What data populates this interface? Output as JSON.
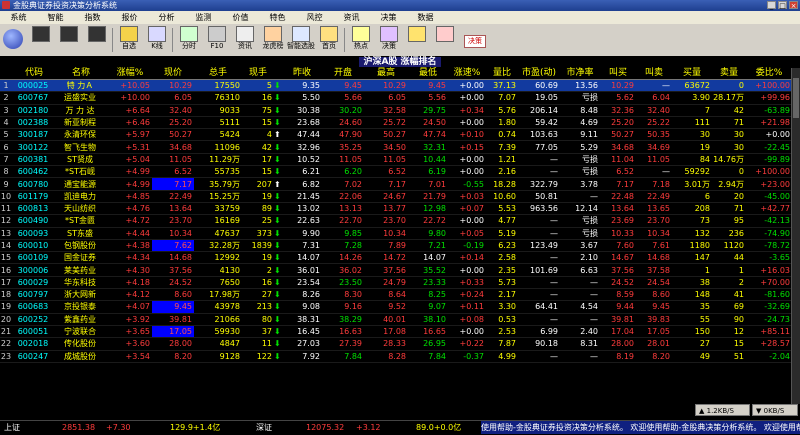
{
  "window": {
    "title": "金股典证券投资决策分析系统"
  },
  "menu": [
    "系统",
    "智能",
    "指数",
    "报价",
    "分析",
    "监测",
    "价值",
    "特色",
    "风控",
    "资讯",
    "决策",
    "数据"
  ],
  "toolbar": [
    {
      "label": "",
      "icon": "dark-panel-icon"
    },
    {
      "label": "",
      "icon": "dark-panel-icon"
    },
    {
      "label": "",
      "icon": "dark-panel-icon"
    },
    {
      "label": "自选",
      "icon": "watchlist-icon"
    },
    {
      "label": "K线",
      "icon": "kline-icon"
    },
    {
      "label": "分时",
      "icon": "intraday-icon"
    },
    {
      "label": "F10",
      "icon": "f10-icon"
    },
    {
      "label": "资讯",
      "icon": "news-icon"
    },
    {
      "label": "龙虎榜",
      "icon": "ranking-icon"
    },
    {
      "label": "智能选股",
      "icon": "smart-pick-icon"
    },
    {
      "label": "首页",
      "icon": "home-icon"
    },
    {
      "label": "热点",
      "icon": "hotspot-icon"
    },
    {
      "label": "决策",
      "icon": "decision-icon"
    },
    {
      "label": "",
      "icon": "star-icon"
    },
    {
      "label": "",
      "icon": "flag-icon"
    }
  ],
  "control_button": "决策",
  "sheet": {
    "title": "沪深A股 涨幅排名"
  },
  "columns": [
    "",
    "代码",
    "名称",
    "涨幅%",
    "现价",
    "总手",
    "现手",
    "",
    "昨收",
    "开盘",
    "最高",
    "最低",
    "涨速%",
    "量比",
    "市盈(动)",
    "市净率",
    "叫买",
    "叫卖",
    "买量",
    "卖量",
    "委比%"
  ],
  "rows": [
    [
      "1",
      "000025",
      "特 力Ａ",
      "+10.05",
      "10.29",
      "17550",
      "5",
      "dn",
      "9.35",
      "9.45",
      "10.29",
      "9.45",
      "+0.00",
      "37.13",
      "60.69",
      "13.56",
      "10.29",
      "—",
      "63672",
      "0",
      "+100.00"
    ],
    [
      "2",
      "600767",
      "运盛实业",
      "+10.00",
      "6.05",
      "76310",
      "16",
      "dn",
      "5.50",
      "5.66",
      "6.05",
      "5.56",
      "+0.00",
      "7.07",
      "19.05",
      "亏损",
      "5.62",
      "6.04",
      "3.90",
      "28.17万",
      "+99.96"
    ],
    [
      "3",
      "002180",
      "万 力 达",
      "+6.64",
      "32.40",
      "9033",
      "75",
      "dn",
      "30.38",
      "30.20",
      "32.58",
      "29.75",
      "+0.34",
      "5.76",
      "206.14",
      "8.48",
      "32.36",
      "32.40",
      "7",
      "42",
      "-63.89"
    ],
    [
      "4",
      "002388",
      "新亚制程",
      "+6.46",
      "25.20",
      "5111",
      "15",
      "dn",
      "23.68",
      "24.60",
      "25.72",
      "24.50",
      "+0.00",
      "1.80",
      "59.42",
      "4.69",
      "25.20",
      "25.22",
      "111",
      "71",
      "+21.98"
    ],
    [
      "5",
      "300187",
      "永清环保",
      "+5.97",
      "50.27",
      "5424",
      "4",
      "up",
      "47.44",
      "47.90",
      "50.27",
      "47.74",
      "+0.10",
      "0.74",
      "103.63",
      "9.11",
      "50.27",
      "50.35",
      "30",
      "30",
      "+0.00"
    ],
    [
      "6",
      "300122",
      "智飞生物",
      "+5.31",
      "34.68",
      "11096",
      "42",
      "dn",
      "32.96",
      "35.25",
      "34.50",
      "32.31",
      "+0.15",
      "7.39",
      "77.05",
      "5.29",
      "34.68",
      "34.69",
      "19",
      "30",
      "-22.45"
    ],
    [
      "7",
      "600381",
      "ST贤成",
      "+5.04",
      "11.05",
      "11.29万",
      "17",
      "dn",
      "10.52",
      "11.05",
      "11.05",
      "10.44",
      "+0.00",
      "1.21",
      "—",
      "亏损",
      "11.04",
      "11.05",
      "84",
      "14.76万",
      "-99.89"
    ],
    [
      "8",
      "600462",
      "*ST石岘",
      "+4.99",
      "6.52",
      "55735",
      "15",
      "dn",
      "6.21",
      "6.20",
      "6.52",
      "6.19",
      "+0.00",
      "2.16",
      "—",
      "亏损",
      "6.52",
      "—",
      "59292",
      "0",
      "+100.00"
    ],
    [
      "9",
      "600780",
      "通宝能源",
      "+4.99",
      "7.17",
      "35.79万",
      "207",
      "up",
      "6.82",
      "7.02",
      "7.17",
      "7.01",
      "-0.55",
      "18.28",
      "322.79",
      "3.78",
      "7.17",
      "7.18",
      "3.01万",
      "2.94万",
      "+23.00"
    ],
    [
      "10",
      "601179",
      "凯迪电力",
      "+4.85",
      "22.49",
      "15.25万",
      "19",
      "dn",
      "21.45",
      "22.06",
      "24.67",
      "21.79",
      "+0.03",
      "10.60",
      "50.81",
      "—",
      "22.48",
      "22.49",
      "6",
      "20",
      "-45.00"
    ],
    [
      "11",
      "600813",
      "天山纺织",
      "+4.76",
      "13.64",
      "33759",
      "89",
      "dn",
      "13.02",
      "13.13",
      "13.77",
      "12.98",
      "+0.07",
      "5.53",
      "963.56",
      "12.14",
      "13.64",
      "13.65",
      "208",
      "71",
      "+42.77"
    ],
    [
      "12",
      "600490",
      "*ST金匮",
      "+4.72",
      "23.70",
      "16169",
      "25",
      "dn",
      "22.63",
      "22.70",
      "23.70",
      "22.72",
      "+0.00",
      "4.77",
      "—",
      "亏损",
      "23.69",
      "23.70",
      "73",
      "95",
      "-42.13"
    ],
    [
      "13",
      "600093",
      "ST东盛",
      "+4.44",
      "10.34",
      "47637",
      "373",
      "dn",
      "9.90",
      "9.85",
      "10.34",
      "9.80",
      "+0.05",
      "5.19",
      "—",
      "亏损",
      "10.33",
      "10.34",
      "132",
      "236",
      "-74.90"
    ],
    [
      "14",
      "600010",
      "包钢股份",
      "+4.38",
      "7.62",
      "32.28万",
      "1839",
      "dn",
      "7.31",
      "7.28",
      "7.89",
      "7.21",
      "-0.19",
      "6.23",
      "123.49",
      "3.67",
      "7.60",
      "7.61",
      "1180",
      "1120",
      "-78.72"
    ],
    [
      "15",
      "600109",
      "国金证券",
      "+4.34",
      "14.68",
      "12992",
      "19",
      "dn",
      "14.07",
      "14.26",
      "14.72",
      "14.07",
      "+0.14",
      "2.58",
      "—",
      "2.10",
      "14.67",
      "14.68",
      "147",
      "44",
      "-3.65"
    ],
    [
      "16",
      "300006",
      "莱美药业",
      "+4.30",
      "37.56",
      "4130",
      "2",
      "dn",
      "36.01",
      "36.02",
      "37.56",
      "35.52",
      "+0.00",
      "2.35",
      "101.69",
      "6.63",
      "37.56",
      "37.58",
      "1",
      "1",
      "+16.03"
    ],
    [
      "17",
      "600029",
      "华东科技",
      "+4.18",
      "24.52",
      "7650",
      "16",
      "dn",
      "23.54",
      "23.50",
      "24.79",
      "23.33",
      "+0.33",
      "5.73",
      "—",
      "—",
      "24.52",
      "24.54",
      "38",
      "2",
      "+70.00"
    ],
    [
      "18",
      "600797",
      "浙大网新",
      "+4.12",
      "8.60",
      "17.98万",
      "27",
      "dn",
      "8.26",
      "8.30",
      "8.64",
      "8.25",
      "+0.24",
      "2.17",
      "—",
      "—",
      "8.59",
      "8.60",
      "148",
      "41",
      "-81.60"
    ],
    [
      "19",
      "600683",
      "京投银泰",
      "+4.07",
      "9.45",
      "43978",
      "213",
      "dn",
      "9.08",
      "9.16",
      "9.52",
      "9.07",
      "+0.11",
      "3.30",
      "64.41",
      "4.54",
      "9.44",
      "9.45",
      "35",
      "69",
      "-32.69"
    ],
    [
      "20",
      "600252",
      "紫鑫药业",
      "+3.92",
      "39.81",
      "21066",
      "80",
      "dn",
      "38.31",
      "38.29",
      "40.01",
      "38.10",
      "+0.08",
      "0.53",
      "—",
      "—",
      "39.81",
      "39.83",
      "55",
      "90",
      "-24.73"
    ],
    [
      "21",
      "600051",
      "宁波联合",
      "+3.65",
      "17.05",
      "59930",
      "37",
      "dn",
      "16.45",
      "16.63",
      "17.08",
      "16.65",
      "+0.00",
      "2.53",
      "6.99",
      "2.40",
      "17.04",
      "17.05",
      "150",
      "12",
      "+85.11"
    ],
    [
      "22",
      "002018",
      "传化股份",
      "+3.60",
      "28.00",
      "4847",
      "11",
      "dn",
      "27.03",
      "27.39",
      "28.33",
      "26.95",
      "+0.22",
      "7.87",
      "90.18",
      "8.31",
      "28.00",
      "28.01",
      "27",
      "15",
      "+28.57"
    ],
    [
      "23",
      "600247",
      "成城股份",
      "+3.54",
      "8.20",
      "9128",
      "122",
      "dn",
      "7.92",
      "7.84",
      "8.28",
      "7.84",
      "-0.37",
      "4.99",
      "—",
      "—",
      "8.19",
      "8.20",
      "49",
      "51",
      "-2.04"
    ]
  ],
  "highlight_rows": [
    9,
    14,
    19,
    21
  ],
  "status": {
    "sh_label": "上证",
    "sh_value": "2851.38",
    "sh_change": "+7.30",
    "sh_amount": "129.9+1.4亿",
    "sz_label": "深证",
    "sz_value": "12075.32",
    "sz_change": "+3.12",
    "sz_amount": "89.0+0.0亿",
    "marquee": "使用帮助-金股典证券投资决策分析系统。 欢迎使用帮助-金股典决策分析系统。 欢迎使用帮助",
    "net_up": "1.2KB/S",
    "net_down": "0KB/S"
  },
  "colors": {
    "up": "#ff3c3c",
    "down": "#00e000",
    "header": "#ffff00",
    "code": "#00ffff",
    "selected_row": "#123a9f"
  }
}
